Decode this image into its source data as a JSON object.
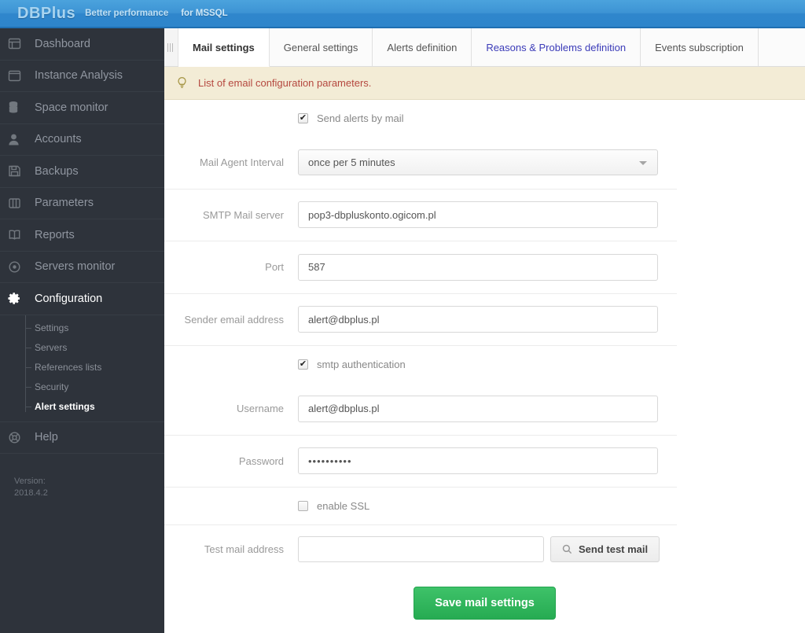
{
  "header": {
    "brand": "DBPlus",
    "tagline": "Better performance",
    "product": "for MSSQL"
  },
  "sidebar": {
    "items": [
      {
        "label": "Dashboard",
        "icon": "dashboard-icon",
        "active": false
      },
      {
        "label": "Instance Analysis",
        "icon": "instance-icon",
        "active": false
      },
      {
        "label": "Space monitor",
        "icon": "database-icon",
        "active": false
      },
      {
        "label": "Accounts",
        "icon": "user-icon",
        "active": false
      },
      {
        "label": "Backups",
        "icon": "save-icon",
        "active": false
      },
      {
        "label": "Parameters",
        "icon": "columns-icon",
        "active": false
      },
      {
        "label": "Reports",
        "icon": "book-icon",
        "active": false
      },
      {
        "label": "Servers monitor",
        "icon": "target-icon",
        "active": false
      },
      {
        "label": "Configuration",
        "icon": "gear-icon",
        "active": true
      }
    ],
    "subitems": [
      {
        "label": "Settings",
        "active": false
      },
      {
        "label": "Servers",
        "active": false
      },
      {
        "label": "References lists",
        "active": false
      },
      {
        "label": "Security",
        "active": false
      },
      {
        "label": "Alert settings",
        "active": true
      }
    ],
    "help": {
      "label": "Help",
      "icon": "help-icon"
    },
    "version_label": "Version:",
    "version_value": "2018.4.2"
  },
  "tabs": [
    {
      "label": "Mail settings",
      "state": "active"
    },
    {
      "label": "General settings",
      "state": "normal"
    },
    {
      "label": "Alerts definition",
      "state": "normal"
    },
    {
      "label": "Reasons & Problems definition",
      "state": "link"
    },
    {
      "label": "Events subscription",
      "state": "normal"
    }
  ],
  "infobar": {
    "icon": "lightbulb-icon",
    "text": "List of email configuration parameters."
  },
  "form": {
    "send_alerts": {
      "label": "Send alerts by mail",
      "checked": true
    },
    "mail_agent_interval": {
      "label": "Mail Agent Interval",
      "value": "once per 5 minutes"
    },
    "smtp_server": {
      "label": "SMTP Mail server",
      "value": "pop3-dbpluskonto.ogicom.pl",
      "placeholder": ""
    },
    "port": {
      "label": "Port",
      "value": "587",
      "placeholder": ""
    },
    "sender_email": {
      "label": "Sender email address",
      "value": "alert@dbplus.pl",
      "placeholder": ""
    },
    "smtp_auth": {
      "label": "smtp authentication",
      "checked": true
    },
    "username": {
      "label": "Username",
      "value": "alert@dbplus.pl",
      "placeholder": ""
    },
    "password": {
      "label": "Password",
      "value": "••••••••••",
      "placeholder": ""
    },
    "enable_ssl": {
      "label": "enable SSL",
      "checked": false
    },
    "test_mail": {
      "label": "Test mail address",
      "value": "",
      "placeholder": ""
    },
    "send_test_button": {
      "label": "Send test mail",
      "icon": "magnifier-icon"
    },
    "save_button": {
      "label": "Save mail settings"
    }
  },
  "colors": {
    "header_blue": "#2f86cc",
    "sidebar_dark": "#2e333b",
    "info_bg": "#f3ecd6",
    "info_text": "#b5483f",
    "save_green": "#26ab52",
    "tab_link": "#3b3bb8"
  }
}
